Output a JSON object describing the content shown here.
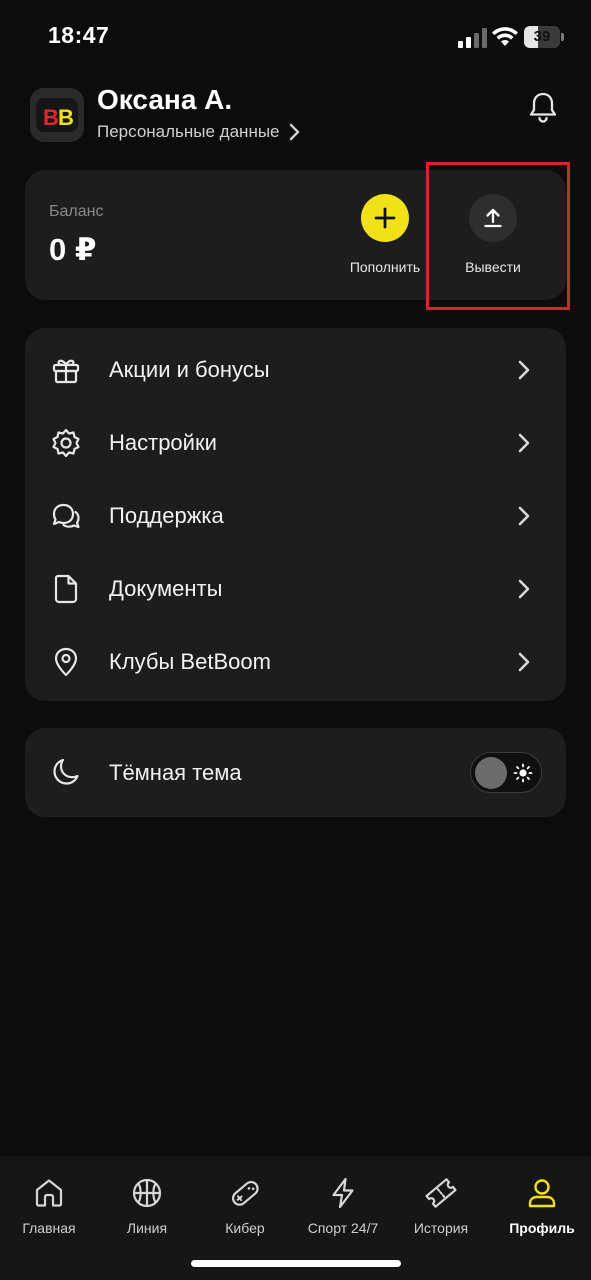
{
  "status_bar": {
    "time": "18:47",
    "battery_level": "39",
    "battery_fraction": 0.39
  },
  "header": {
    "user_name": "Оксана А.",
    "personal_data_link": "Персональные данные",
    "avatar_logo_text": "BB"
  },
  "balance": {
    "label": "Баланс",
    "value": "0 ₽",
    "topup_label": "Пополнить",
    "withdraw_label": "Вывести"
  },
  "menu": {
    "items": [
      {
        "label": "Акции и бонусы",
        "icon": "gift-icon"
      },
      {
        "label": "Настройки",
        "icon": "gear-icon"
      },
      {
        "label": "Поддержка",
        "icon": "chat-icon"
      },
      {
        "label": "Документы",
        "icon": "document-icon"
      },
      {
        "label": "Клубы BetBoom",
        "icon": "location-pin-icon"
      }
    ]
  },
  "theme": {
    "label": "Тёмная тема",
    "toggle_on": false
  },
  "bottom_nav": {
    "items": [
      {
        "label": "Главная",
        "icon": "home-icon",
        "active": false
      },
      {
        "label": "Линия",
        "icon": "basketball-icon",
        "active": false
      },
      {
        "label": "Кибер",
        "icon": "gamepad-icon",
        "active": false
      },
      {
        "label": "Спорт 24/7",
        "icon": "lightning-icon",
        "active": false
      },
      {
        "label": "История",
        "icon": "ticket-icon",
        "active": false
      },
      {
        "label": "Профиль",
        "icon": "user-icon",
        "active": true
      }
    ]
  },
  "colors": {
    "accent_yellow": "#f2e118",
    "highlight_red": "#d9232e",
    "card_bg": "#1d1d1d",
    "page_bg": "#0c0c0c"
  }
}
